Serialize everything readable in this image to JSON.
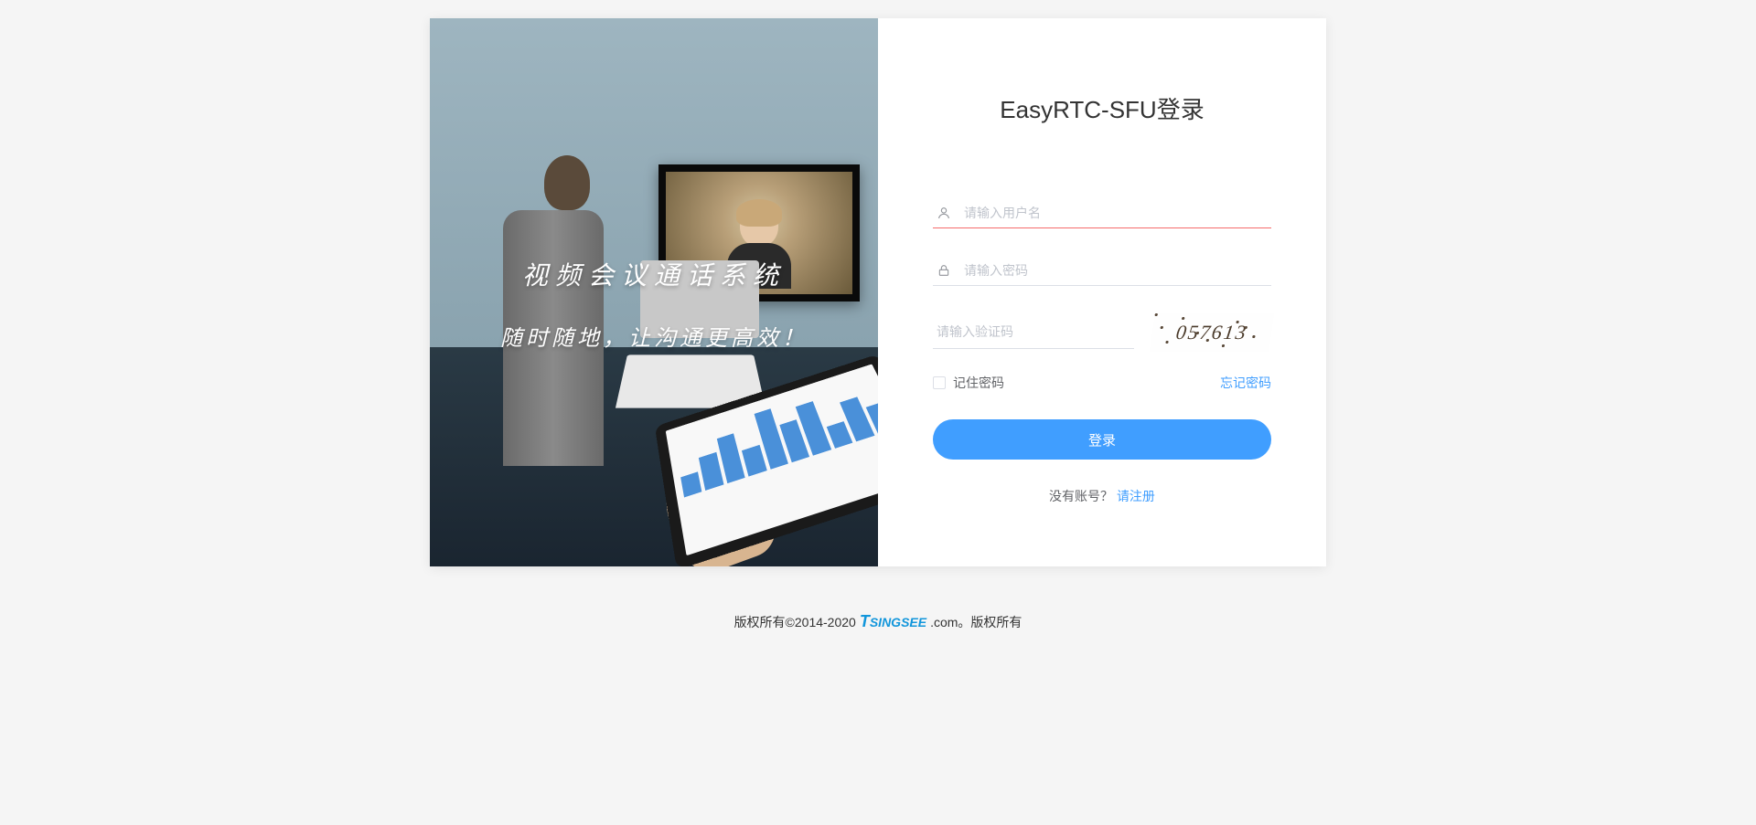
{
  "left": {
    "slogan1": "视频会议通话系统",
    "slogan2": "随时随地，让沟通更高效！"
  },
  "form": {
    "title": "EasyRTC-SFU登录",
    "username_placeholder": "请输入用户名",
    "password_placeholder": "请输入密码",
    "captcha_placeholder": "请输入验证码",
    "captcha_text": "057613",
    "remember_label": "记住密码",
    "forgot_label": "忘记密码",
    "submit_label": "登录",
    "no_account_text": "没有账号？",
    "register_link": "请注册"
  },
  "footer": {
    "copyright_prefix": "版权所有©2014-2020",
    "brand": "TSINGSEE",
    "copyright_suffix": ".com。版权所有"
  }
}
